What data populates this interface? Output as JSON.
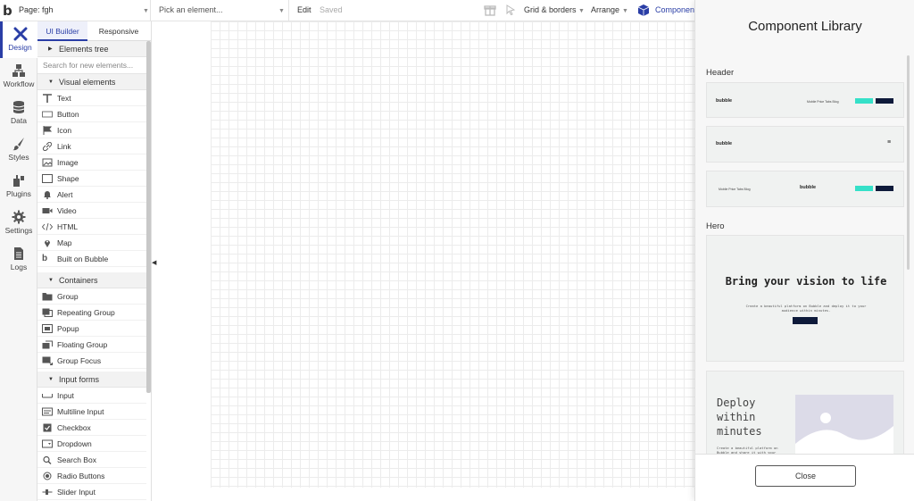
{
  "topbar": {
    "logo": "b",
    "page_label": "Page: fgh",
    "pick_placeholder": "Pick an element...",
    "edit_label": "Edit",
    "saved_label": "Saved",
    "grid_label": "Grid & borders",
    "arrange_label": "Arrange",
    "components_label": "Components"
  },
  "rail": {
    "items": [
      {
        "label": "Design",
        "icon": "design-icon"
      },
      {
        "label": "Workflow",
        "icon": "workflow-icon"
      },
      {
        "label": "Data",
        "icon": "data-icon"
      },
      {
        "label": "Styles",
        "icon": "styles-icon"
      },
      {
        "label": "Plugins",
        "icon": "plugins-icon"
      },
      {
        "label": "Settings",
        "icon": "settings-icon"
      },
      {
        "label": "Logs",
        "icon": "logs-icon"
      }
    ]
  },
  "panel": {
    "tab_builder": "UI Builder",
    "tab_responsive": "Responsive",
    "elements_tree": "Elements tree",
    "search_placeholder": "Search for new elements...",
    "visual_section": "Visual elements",
    "visual_items": [
      "Text",
      "Button",
      "Icon",
      "Link",
      "Image",
      "Shape",
      "Alert",
      "Video",
      "HTML",
      "Map",
      "Built on Bubble"
    ],
    "containers_section": "Containers",
    "container_items": [
      "Group",
      "Repeating Group",
      "Popup",
      "Floating Group",
      "Group Focus"
    ],
    "inputs_section": "Input forms",
    "input_items": [
      "Input",
      "Multiline Input",
      "Checkbox",
      "Dropdown",
      "Search Box",
      "Radio Buttons",
      "Slider Input"
    ]
  },
  "library": {
    "title": "Component Library",
    "header_label": "Header",
    "hero_label": "Hero",
    "brand": "bubble",
    "nav_links": "Mobile Price   Tabs   Blog",
    "login": "Log In",
    "signup": "Sign up",
    "menu_icon": "≡",
    "hero_title": "Bring your vision to life",
    "hero_sub": "Create a beautiful platform on Bubble and deploy it to your audience within minutes.",
    "hero_button": "Sign Up",
    "deploy_title": "Deploy within minutes",
    "deploy_sub": "Create a beautiful platform on Bubble and share it with your audience",
    "close_label": "Close"
  }
}
